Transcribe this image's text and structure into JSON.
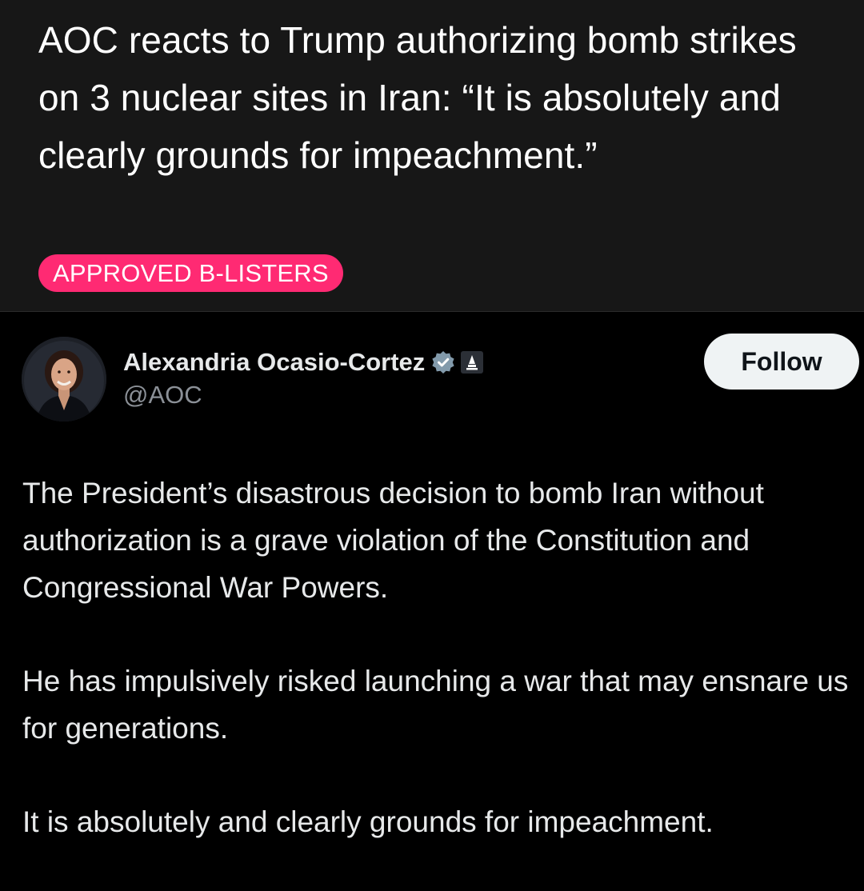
{
  "post": {
    "title": "AOC reacts to Trump authorizing bomb strikes on 3 nuclear sites in Iran: “It is absolutely and clearly grounds for impeachment.”",
    "flair": "APPROVED B-LISTERS",
    "flair_color": "#ff2a73"
  },
  "tweet": {
    "author_name": "Alexandria Ocasio-Cortez",
    "handle": "@AOC",
    "follow_label": "Follow",
    "badges": [
      "verified-badge-icon",
      "government-capitol-icon"
    ],
    "paragraphs": [
      "The President’s disastrous decision to bomb Iran without authorization is a grave violation of the Constitution and Congressional War Powers.",
      "He has impulsively risked launching a war that may ensnare us for generations.",
      "It is absolutely and clearly grounds for impeachment."
    ]
  },
  "colors": {
    "background": "#000000",
    "header_background": "#171717",
    "text_primary": "#e7e9ea",
    "text_secondary": "#8b9097",
    "button_background": "#eff3f4"
  }
}
